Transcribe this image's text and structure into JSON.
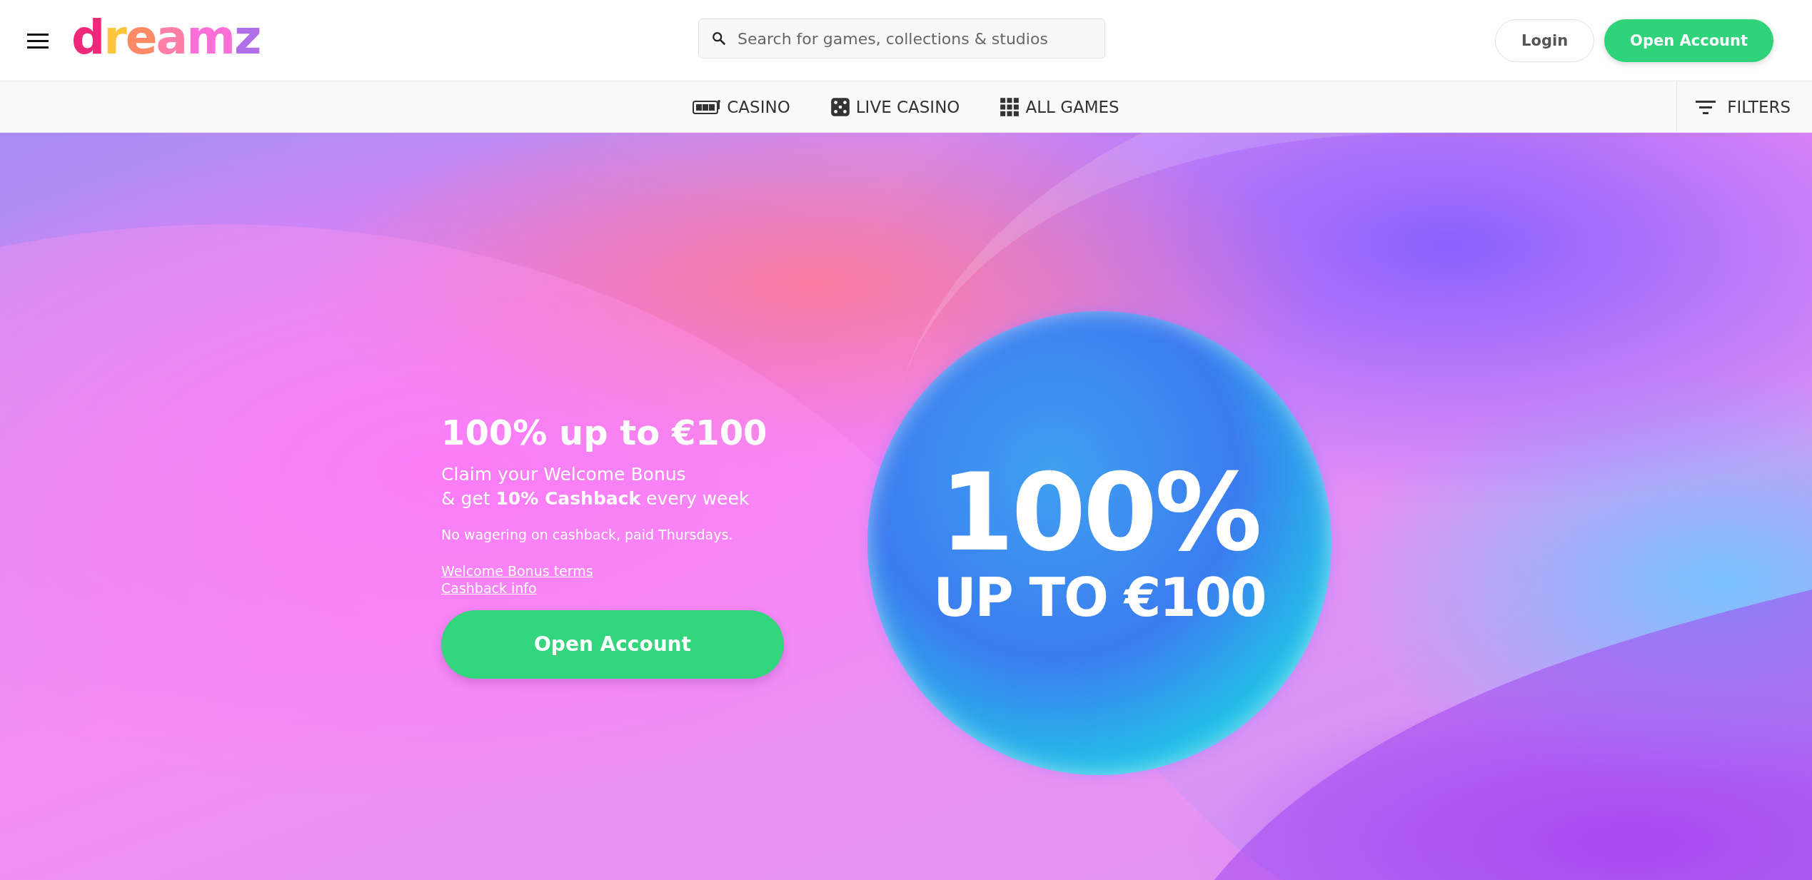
{
  "header": {
    "logo": "dreamz",
    "search": {
      "placeholder": "Search for games, collections & studios"
    },
    "buttons": [
      {
        "label": "Login",
        "kind": "outline"
      },
      {
        "label": "Open Account",
        "kind": "primary"
      }
    ]
  },
  "nav": {
    "items": [
      {
        "label": "CASINO",
        "kind": "slot"
      },
      {
        "label": "LIVE CASINO",
        "kind": "dice"
      },
      {
        "label": "ALL GAMES",
        "kind": "grid"
      }
    ],
    "filters": "FILTERS"
  },
  "hero": {
    "title": "100% up to €100",
    "subtitle_line_1": "Claim your Welcome Bonus",
    "subtitle_line_2": "& get **10% Cashback** every week",
    "note": "No wagering on cashback, paid Thursdays.",
    "links": [
      "Welcome Bonus terms",
      "Cashback info"
    ],
    "button": "Open Account",
    "bubble_line_1": "100%",
    "bubble_line_2": "UP TO €100"
  }
}
